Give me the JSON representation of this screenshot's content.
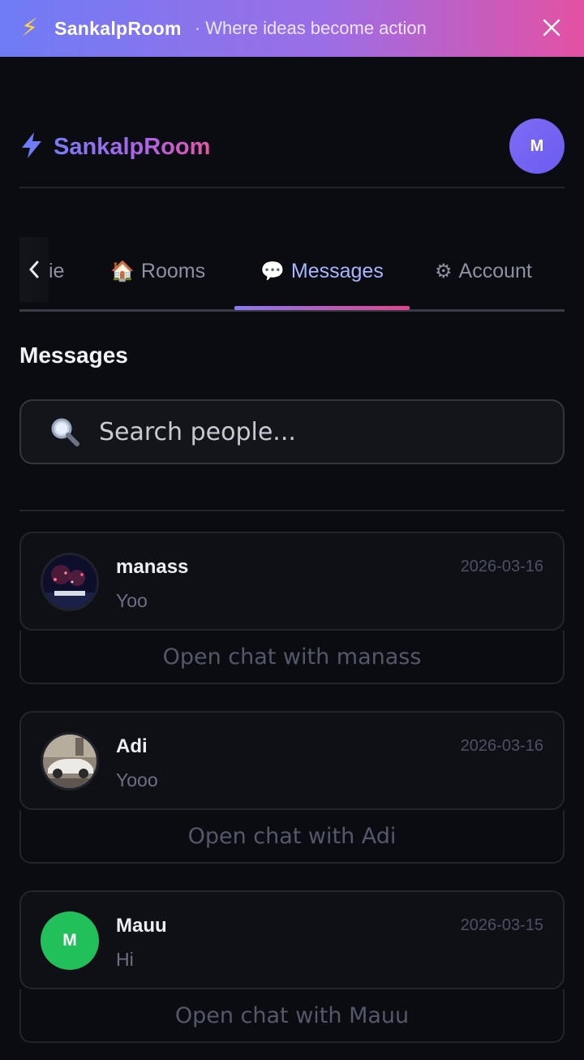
{
  "banner": {
    "brand": "SankalpRoom",
    "tagline": "· Where ideas become action",
    "close_glyph": "✕",
    "bolt_icon": "⚡"
  },
  "header": {
    "logo_icon": "⚡",
    "logo_text": "SankalpRoom",
    "avatar_letter": "M"
  },
  "tabs": {
    "scroll_glyph": "‹",
    "items": [
      {
        "icon": "",
        "label": "ie"
      },
      {
        "icon": "🏠",
        "label": "Rooms"
      },
      {
        "icon": "💬",
        "label": "Messages"
      },
      {
        "icon": "⚙",
        "label": "Account"
      }
    ],
    "active_index": 2
  },
  "page": {
    "title": "Messages"
  },
  "search": {
    "placeholder": "Search people...",
    "value": ""
  },
  "conversations": [
    {
      "name": "manass",
      "preview": "Yoo",
      "date": "2026-03-16",
      "avatar_type": "photo-night-scene",
      "open_label": "Open chat with manass"
    },
    {
      "name": "Adi",
      "preview": "Yooo",
      "date": "2026-03-16",
      "avatar_type": "photo-white-car",
      "open_label": "Open chat with Adi"
    },
    {
      "name": "Mauu",
      "preview": "Hi",
      "date": "2026-03-15",
      "avatar_type": "letter",
      "avatar_letter": "M",
      "avatar_color": "#22c05a",
      "open_label": "Open chat with Mauu"
    }
  ],
  "colors": {
    "accent": "#a8b6ff",
    "banner_start": "#6f7cf5",
    "banner_end": "#e351a3",
    "background": "#0b0c11"
  }
}
